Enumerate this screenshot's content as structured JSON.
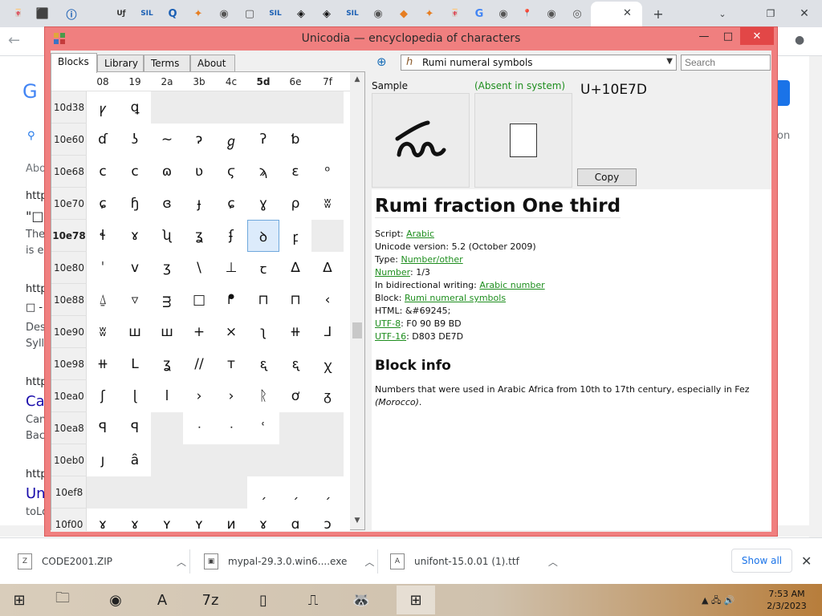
{
  "browser": {
    "tab_icons": [
      "🀄",
      "⬛",
      "ⓘ",
      "Uƒ",
      "SIL",
      "Q",
      "✦",
      "◉",
      "▢",
      "SIL",
      "◈",
      "◈",
      "SIL",
      "◉",
      "◆",
      "✦",
      "🀄",
      "G",
      "◉",
      "📍",
      "◉",
      "◎",
      "▶"
    ],
    "new_tab": "+",
    "tab_close": "✕",
    "behind_text": {
      "left_g": "G",
      "about": "Abo",
      "http1": "http",
      "quote": "\"□",
      "the": "The",
      "ise": "is e",
      "http2": "http",
      "box": "□ -",
      "des": "Des",
      "syl": "Syll",
      "http3": "http",
      "ca": "Ca",
      "can": "Can",
      "bac": "Bac",
      "http4": "http",
      "un": "Un",
      "tol": "toLo",
      "on": "on"
    }
  },
  "app": {
    "title": "Unicodia — encyclopedia of characters",
    "window_controls": {
      "minimize": "—",
      "maximize": "□",
      "close": "✕"
    },
    "tabs": [
      {
        "label": "Blocks",
        "active": true
      },
      {
        "label": "Library",
        "active": false
      },
      {
        "label": "Terms",
        "active": false
      },
      {
        "label": "About",
        "active": false
      }
    ],
    "grid": {
      "columns": [
        "08",
        "19",
        "2a",
        "3b",
        "4c",
        "5d",
        "6e",
        "7f"
      ],
      "bold_column": "5d",
      "rows": [
        {
          "label": "10d38",
          "cells": [
            "ꝩ",
            "ꝗ",
            "",
            "",
            "",
            "",
            "",
            ""
          ],
          "empty": [
            2,
            3,
            4,
            5,
            6,
            7
          ]
        },
        {
          "label": "10e60",
          "cells": [
            "ɗ",
            "ʖ",
            "~",
            "ɂ",
            "ℊ",
            "ʔ",
            "ƅ",
            ""
          ],
          "empty": []
        },
        {
          "label": "10e68",
          "cells": [
            "ϲ",
            "c",
            "ɷ",
            "ʋ",
            "ϛ",
            "ϡ",
            "ɛ",
            "ᵒ"
          ],
          "empty": []
        },
        {
          "label": "10e70",
          "cells": [
            "ɕ",
            "ɧ",
            "ɞ",
            "ɟ",
            "ɕ",
            "ɣ",
            "ρ",
            "ʬ"
          ],
          "empty": []
        },
        {
          "label": "10e78",
          "cells": [
            "ɬ",
            "ɤ",
            "ʯ",
            "ʓ",
            "ʄ",
            "ꝺ",
            "ꝼ",
            ""
          ],
          "empty": [
            7
          ]
        },
        {
          "label": "10e80",
          "cells": [
            "ˈ",
            "v",
            "ʒ",
            "\\",
            "⊥",
            "ꞇ",
            "∆",
            "ᐃ"
          ],
          "empty": []
        },
        {
          "label": "10e88",
          "cells": [
            "⍙",
            "▿",
            "ᴟ",
            "□",
            "ᖰ",
            "⊓",
            "⊓",
            "‹"
          ],
          "empty": []
        },
        {
          "label": "10e90",
          "cells": [
            "ʬ",
            "ш",
            "ꟺ",
            "+",
            "×",
            "ʅ",
            "⧺",
            "ᒧ"
          ],
          "empty": []
        },
        {
          "label": "10e98",
          "cells": [
            "⧺",
            "ᒪ",
            "ʓ",
            "//",
            "ᴛ",
            "ᶓ",
            "ᶓ",
            "ꭓ"
          ],
          "empty": []
        },
        {
          "label": "10ea0",
          "cells": [
            "ʃ",
            "ɭ",
            "ⅼ",
            "›",
            "›",
            "ᚱ",
            "ơ",
            "ᵹ"
          ],
          "empty": []
        },
        {
          "label": "10ea8",
          "cells": [
            "ꟼ",
            "ꟼ",
            "",
            "ᐧ",
            "ᐧ",
            "ʿ",
            "",
            ""
          ],
          "empty": [
            2,
            6,
            7
          ]
        },
        {
          "label": "10eb0",
          "cells": [
            "ȷ",
            "ȃ",
            "",
            "",
            "",
            "",
            "",
            ""
          ],
          "empty": [
            2,
            3,
            4,
            5,
            6,
            7
          ]
        },
        {
          "label": "10ef8",
          "cells": [
            "",
            "",
            "",
            "",
            "",
            "ˏ",
            "ˏ",
            "ˏ"
          ],
          "empty": [
            0,
            1,
            2,
            3,
            4
          ]
        },
        {
          "label": "10f00",
          "cells": [
            "ɤ",
            "ɤ",
            "ʏ",
            "ʏ",
            "ᴎ",
            "ɤ",
            "ɑ",
            "ɔ"
          ],
          "empty": []
        }
      ],
      "bold_row": "10e78",
      "selected": {
        "row": 4,
        "col": 5
      }
    },
    "details": {
      "block_select": "Rumi numeral symbols",
      "search_placeholder": "Search",
      "sample_label": "Sample",
      "absent_label": "(Absent in system)",
      "codepoint": "U+10E7D",
      "sample_glyph": "ꝺ",
      "copy_label": "Copy",
      "char_name": "Rumi fraction One third",
      "props": {
        "script_label": "Script:",
        "script_value": "Arabic",
        "unicode_version": "Unicode version: 5.2 (October 2009)",
        "type_label": "Type:",
        "type_value": "Number/other",
        "number_label": "Number",
        "number_value": ": 1/3",
        "bidi_label": "In bidirectional writing:",
        "bidi_value": "Arabic number",
        "block_label": "Block:",
        "block_value": "Rumi numeral symbols",
        "html": "HTML: &#69245;",
        "utf8_label": "UTF-8",
        "utf8_value": ": F0 90 B9 BD",
        "utf16_label": "UTF-16",
        "utf16_value": ": D803 DE7D"
      },
      "block_info_title": "Block info",
      "block_desc_main": "Numbers that were used in Arabic Africa from 10th to 17th century, especially in Fez ",
      "block_desc_italic": "(Morocco)",
      "block_desc_end": "."
    }
  },
  "downloads": {
    "items": [
      "CODE2001.ZIP",
      "mypal-29.3.0.win6....exe",
      "unifont-15.0.01 (1).ttf"
    ],
    "show_all": "Show all",
    "close": "✕"
  },
  "taskbar": {
    "time": "7:53 AM",
    "date": "2/3/2023",
    "apps": [
      "⊞",
      "🗀",
      "◉",
      "A",
      "7z",
      "▯",
      "⎍",
      "🦝",
      "⊞"
    ]
  }
}
